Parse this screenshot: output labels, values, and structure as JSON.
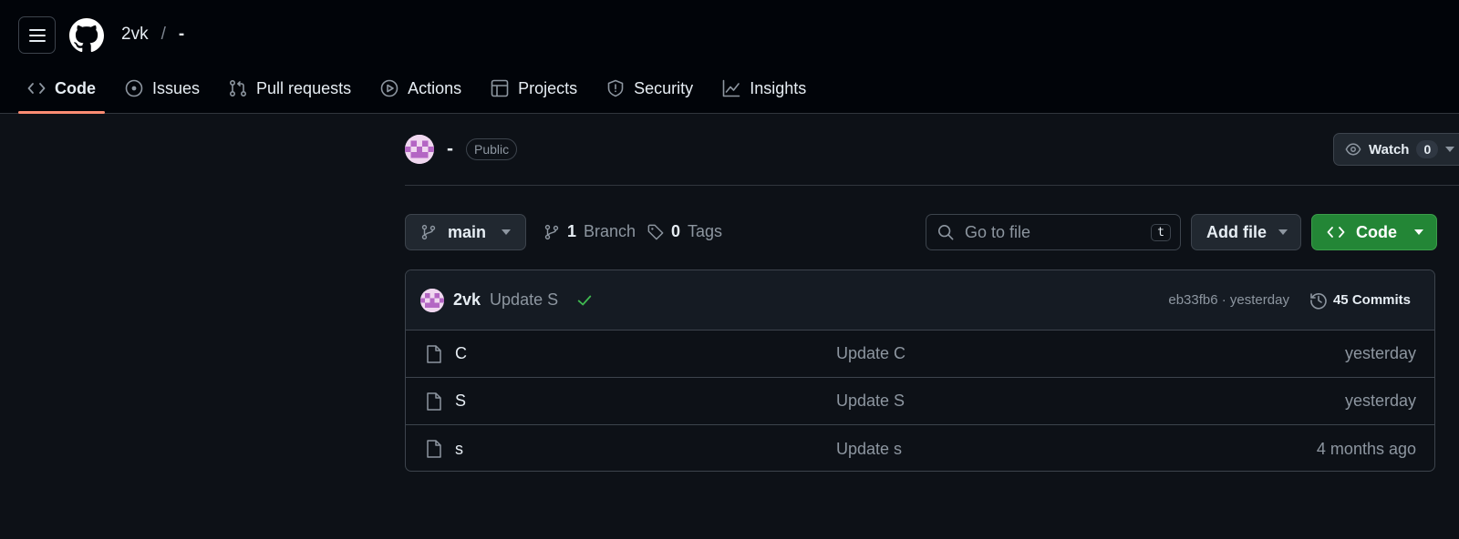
{
  "header": {
    "owner": "2vk",
    "separator": "/",
    "repo": "-"
  },
  "nav": {
    "tabs": [
      {
        "label": "Code",
        "icon": "code-icon",
        "selected": true
      },
      {
        "label": "Issues",
        "icon": "issue-icon"
      },
      {
        "label": "Pull requests",
        "icon": "pull-request-icon"
      },
      {
        "label": "Actions",
        "icon": "play-icon"
      },
      {
        "label": "Projects",
        "icon": "table-icon"
      },
      {
        "label": "Security",
        "icon": "shield-icon"
      },
      {
        "label": "Insights",
        "icon": "graph-icon"
      }
    ]
  },
  "repo": {
    "name": "-",
    "visibility": "Public",
    "watch_label": "Watch",
    "watch_count": "0"
  },
  "toolbar": {
    "branch": "main",
    "branch_count": "1",
    "branch_label": "Branch",
    "tag_count": "0",
    "tag_label": "Tags",
    "search_placeholder": "Go to file",
    "search_shortcut": "t",
    "add_file_label": "Add file",
    "code_label": "Code"
  },
  "latest_commit": {
    "author": "2vk",
    "message": "Update S",
    "meta": "eb33fb6 · yesterday",
    "commits_label": "45 Commits"
  },
  "files": [
    {
      "name": "C",
      "message": "Update C",
      "date": "yesterday"
    },
    {
      "name": "S",
      "message": "Update S",
      "date": "yesterday"
    },
    {
      "name": "s",
      "message": "Update s",
      "date": "4 months ago"
    }
  ],
  "colors": {
    "accent_underline": "#fd8c73",
    "primary_button": "#238636",
    "success_check": "#3fb950",
    "background": "#0d1117"
  }
}
